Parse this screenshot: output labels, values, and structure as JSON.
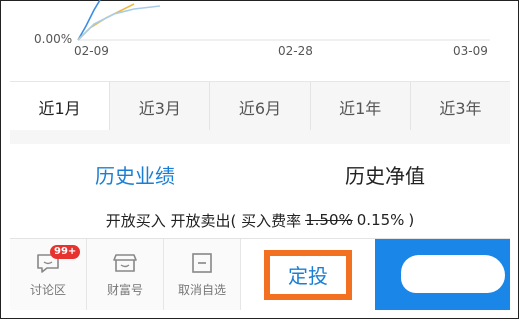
{
  "chart": {
    "y_label": "0.00%",
    "x_labels": [
      "02-09",
      "02-28",
      "03-09"
    ],
    "colors": {
      "series_a": "#3a8ee6",
      "series_b": "#f0b840",
      "series_c": "#a8cdea"
    }
  },
  "period_tabs": [
    {
      "label": "近1月",
      "active": true
    },
    {
      "label": "近3月",
      "active": false
    },
    {
      "label": "近6月",
      "active": false
    },
    {
      "label": "近1年",
      "active": false
    },
    {
      "label": "近3年",
      "active": false
    }
  ],
  "perf_tabs": [
    {
      "label": "历史业绩",
      "active": true
    },
    {
      "label": "历史净值",
      "active": false
    }
  ],
  "status": {
    "text_before": "开放买入 开放卖出( 买入费率",
    "old_rate": "1.50%",
    "new_rate": "0.15%",
    "text_after": ")"
  },
  "bottom_nav": [
    {
      "label": "讨论区",
      "icon": "chat-icon",
      "badge": "99+"
    },
    {
      "label": "财富号",
      "icon": "shop-icon"
    },
    {
      "label": "取消自选",
      "icon": "minus-box-icon"
    }
  ],
  "dingtou_label": "定投",
  "colors": {
    "accent_blue": "#1a7fd4",
    "highlight_orange": "#f37021",
    "badge_red": "#e7332f",
    "panel_blue": "#1a87e8"
  }
}
